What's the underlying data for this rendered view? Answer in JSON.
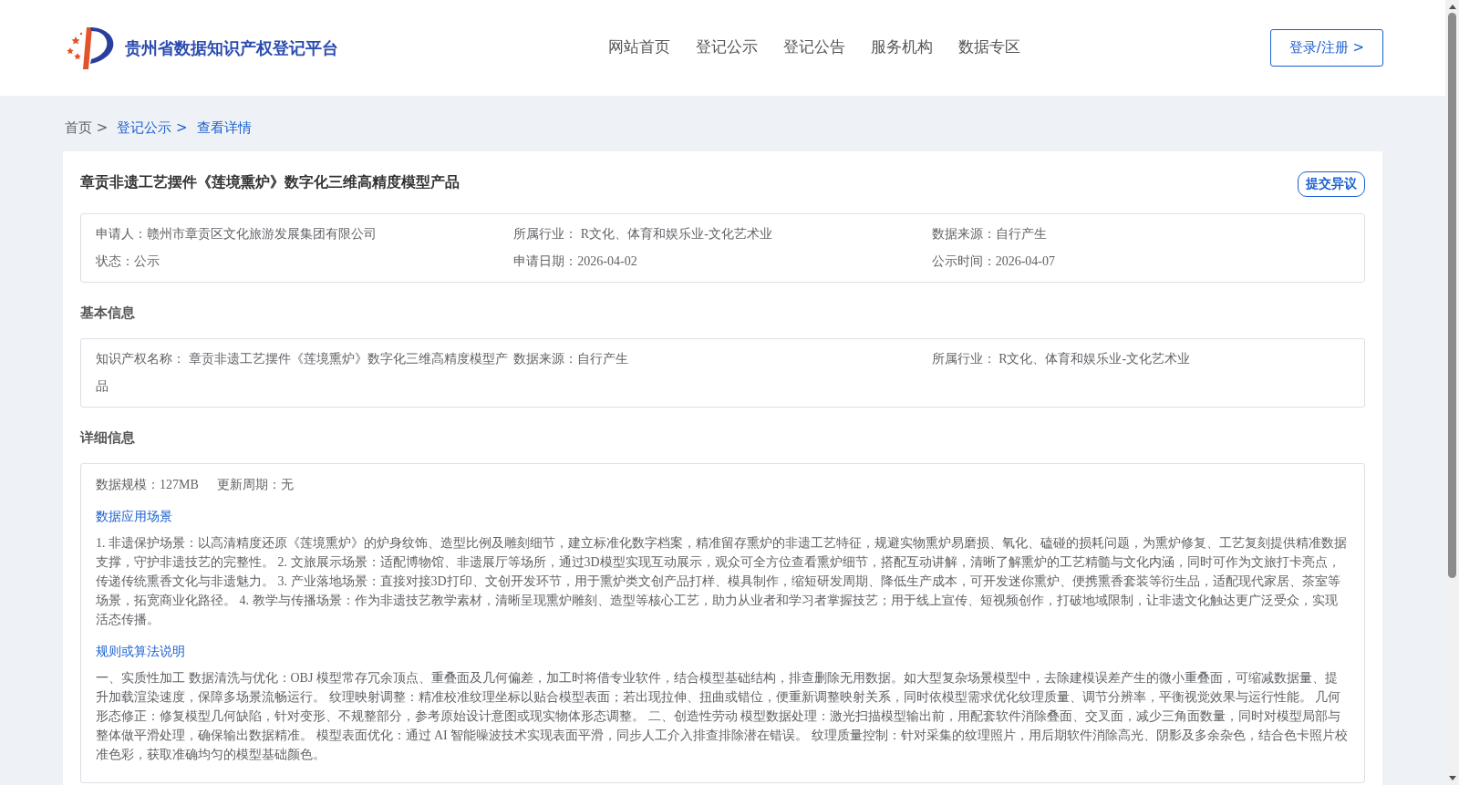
{
  "header": {
    "site_title": "贵州省数据知识产权登记平台",
    "nav": [
      {
        "label": "网站首页",
        "selected": false
      },
      {
        "label": "登记公示",
        "selected": false
      },
      {
        "label": "登记公告",
        "selected": false
      },
      {
        "label": "服务机构",
        "selected": false
      },
      {
        "label": "数据专区",
        "selected": false
      }
    ],
    "login_button": "登录/注册 >"
  },
  "breadcrumb": [
    {
      "label": "首页 >",
      "link": false
    },
    {
      "label": "登记公示 >",
      "link": true
    },
    {
      "label": "查看详情",
      "link": true
    }
  ],
  "detail": {
    "title": "章贡非遗工艺摆件《莲境熏炉》数字化三维高精度模型产品",
    "objection_button": "提交异议",
    "summary": [
      {
        "label": "申请人：",
        "value": "赣州市章贡区文化旅游发展集团有限公司"
      },
      {
        "label": "所属行业：",
        "value": " R文化、体育和娱乐业-文化艺术业"
      },
      {
        "label": "数据来源：",
        "value": "自行产生"
      },
      {
        "label": "状态：",
        "value": "公示"
      },
      {
        "label": "申请日期：",
        "value": "2026-04-02"
      },
      {
        "label": "公示时间：",
        "value": "2026-04-07"
      }
    ],
    "basic_heading": "基本信息",
    "basic": [
      {
        "label": "知识产权名称：",
        "value": " 章贡非遗工艺摆件《莲境熏炉》数字化三维高精度模型产品"
      },
      {
        "label": "数据来源：",
        "value": "自行产生"
      },
      {
        "label": "所属行业：",
        "value": " R文化、体育和娱乐业-文化艺术业"
      }
    ],
    "detail_heading": "详细信息",
    "meta": [
      {
        "label": "数据规模：",
        "value": "127MB"
      },
      {
        "label": "更新周期：",
        "value": "无"
      }
    ],
    "sections": [
      {
        "heading": "数据应用场景",
        "text": "1. 非遗保护场景：以高清精度还原《莲境熏炉》的炉身纹饰、造型比例及雕刻细节，建立标准化数字档案，精准留存熏炉的非遗工艺特征，规避实物熏炉易磨损、氧化、磕碰的损耗问题，为熏炉修复、工艺复刻提供精准数据支撑，守护非遗技艺的完整性。 2. 文旅展示场景：适配博物馆、非遗展厅等场所，通过3D模型实现互动展示，观众可全方位查看熏炉细节，搭配互动讲解，清晰了解熏炉的工艺精髓与文化内涵，同时可作为文旅打卡亮点，传递传统熏香文化与非遗魅力。 3. 产业落地场景：直接对接3D打印、文创开发环节，用于熏炉类文创产品打样、模具制作，缩短研发周期、降低生产成本，可开发迷你熏炉、便携熏香套装等衍生品，适配现代家居、茶室等场景，拓宽商业化路径。 4. 教学与传播场景：作为非遗技艺教学素材，清晰呈现熏炉雕刻、造型等核心工艺，助力从业者和学习者掌握技艺；用于线上宣传、短视频创作，打破地域限制，让非遗文化触达更广泛受众，实现活态传播。"
      },
      {
        "heading": "规则或算法说明",
        "text": "一、实质性加工 数据清洗与优化：OBJ 模型常存冗余顶点、重叠面及几何偏差，加工时将借专业软件，结合模型基础结构，排查删除无用数据。如大型复杂场景模型中，去除建模误差产生的微小重叠面，可缩减数据量、提升加载渲染速度，保障多场景流畅运行。 纹理映射调整：精准校准纹理坐标以贴合模型表面；若出现拉伸、扭曲或错位，便重新调整映射关系，同时依模型需求优化纹理质量、调节分辨率，平衡视觉效果与运行性能。 几何形态修正：修复模型几何缺陷，针对变形、不规整部分，参考原始设计意图或现实物体形态调整。 二、创造性劳动 模型数据处理：激光扫描模型输出前，用配套软件消除叠面、交叉面，减少三角面数量，同时对模型局部与整体做平滑处理，确保输出数据精准。 模型表面优化：通过 AI 智能噪波技术实现表面平滑，同步人工介入排查排除潜在错误。 纹理质量控制：针对采集的纹理照片，用后期软件消除高光、阴影及多余杂色，结合色卡照片校准色彩，获取准确均匀的模型基础颜色。"
      }
    ]
  }
}
